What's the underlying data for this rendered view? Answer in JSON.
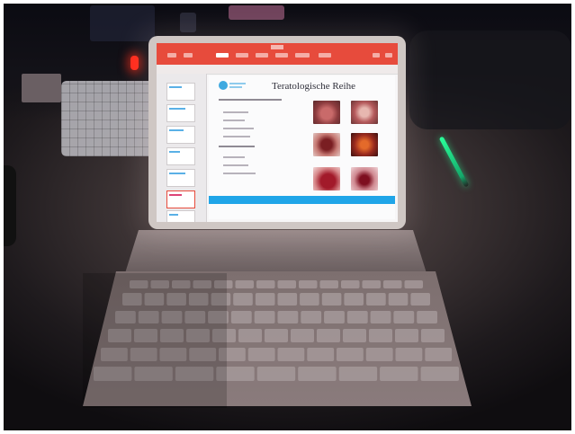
{
  "scene": {
    "slide": {
      "title": "Teratologische Reihe"
    },
    "colors": {
      "ribbon": "#e74b3c",
      "accent_bar": "#20a5e8",
      "pen_glow": "#2aff9a",
      "led": "#ff2a1a"
    }
  }
}
